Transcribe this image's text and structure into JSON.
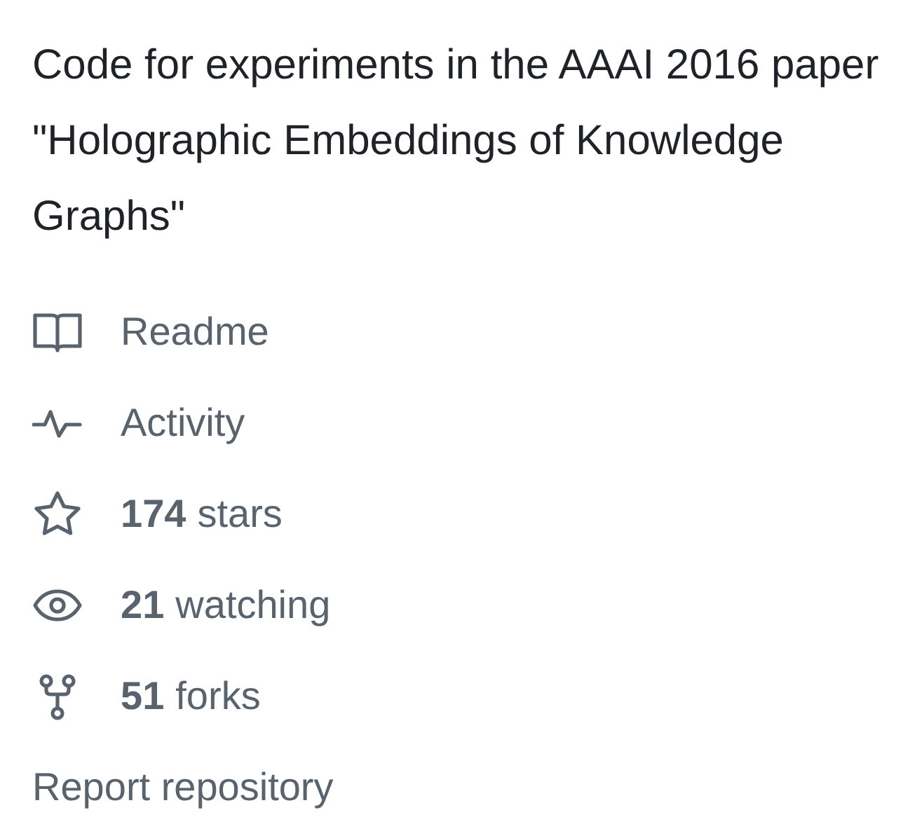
{
  "description": "Code for experiments in the AAAI 2016 paper \"Holographic Embeddings of Knowledge Graphs\"",
  "links": [
    {
      "kind": "readme",
      "label": "Readme"
    },
    {
      "kind": "activity",
      "label": "Activity"
    },
    {
      "kind": "stars",
      "count": "174",
      "label": "stars"
    },
    {
      "kind": "watching",
      "count": "21",
      "label": "watching"
    },
    {
      "kind": "forks",
      "count": "51",
      "label": "forks"
    }
  ],
  "report": "Report repository"
}
